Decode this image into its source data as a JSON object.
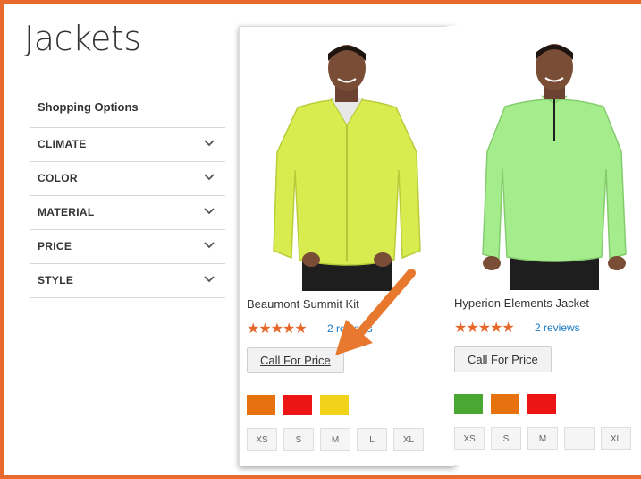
{
  "page_title": "Jackets",
  "sidebar": {
    "heading": "Shopping Options",
    "filters": [
      {
        "label": "CLIMATE"
      },
      {
        "label": "COLOR"
      },
      {
        "label": "MATERIAL"
      },
      {
        "label": "PRICE"
      },
      {
        "label": "STYLE"
      }
    ],
    "chevron_icon": "chevron-down-icon"
  },
  "products": [
    {
      "name": "Beaumont Summit Kit",
      "stars": "★★★★★",
      "rating": 4.5,
      "reviews": "2 reviews",
      "button": "Call For Price",
      "jacket_color": "#d8ec50",
      "swatches": [
        "#e6720f",
        "#ec1414",
        "#f3d21a"
      ],
      "sizes": [
        "XS",
        "S",
        "M",
        "L",
        "XL"
      ]
    },
    {
      "name": "Hyperion Elements Jacket",
      "stars": "★★★★★",
      "rating": 4.5,
      "reviews": "2 reviews",
      "button": "Call For Price",
      "jacket_color": "#a4ec8c",
      "swatches": [
        "#4aa832",
        "#e6720f",
        "#ec1414"
      ],
      "sizes": [
        "XS",
        "S",
        "M",
        "L",
        "XL"
      ]
    }
  ],
  "colors": {
    "accent": "#e86a2c",
    "link": "#1979c3",
    "star": "#e8672a"
  },
  "annotation": {
    "icon": "arrow-icon",
    "color": "#e8782e"
  }
}
